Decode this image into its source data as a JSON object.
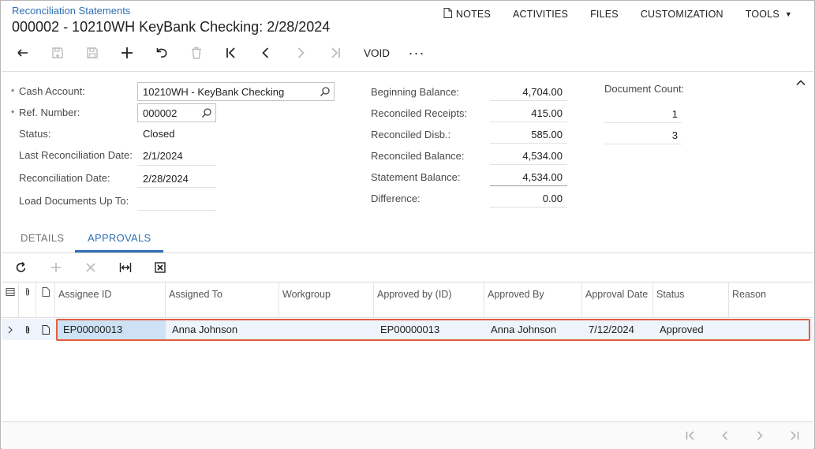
{
  "header": {
    "breadcrumb": "Reconciliation Statements",
    "title": "000002 - 10210WH KeyBank Checking: 2/28/2024",
    "links": {
      "notes": "NOTES",
      "activities": "ACTIVITIES",
      "files": "FILES",
      "customization": "CUSTOMIZATION",
      "tools": "TOOLS"
    }
  },
  "toolbar": {
    "void_label": "VOID",
    "more_label": "···",
    "icons": [
      "back-icon",
      "save-close-icon",
      "save-icon",
      "add-icon",
      "undo-icon",
      "delete-icon",
      "first-icon",
      "prev-icon",
      "next-icon",
      "last-icon"
    ]
  },
  "form": {
    "cash_account": {
      "label": "Cash Account:",
      "value": "10210WH - KeyBank Checking"
    },
    "ref_number": {
      "label": "Ref. Number:",
      "value": "000002"
    },
    "status": {
      "label": "Status:",
      "value": "Closed"
    },
    "last_reconciliation_date": {
      "label": "Last Reconciliation Date:",
      "value": "2/1/2024"
    },
    "reconciliation_date": {
      "label": "Reconciliation Date:",
      "value": "2/28/2024"
    },
    "load_documents_up_to": {
      "label": "Load Documents Up To:",
      "value": ""
    },
    "required_marker": "*"
  },
  "balances": {
    "beginning_balance": {
      "label": "Beginning Balance:",
      "value": "4,704.00"
    },
    "reconciled_receipts": {
      "label": "Reconciled Receipts:",
      "value": "415.00"
    },
    "reconciled_disb": {
      "label": "Reconciled Disb.:",
      "value": "585.00"
    },
    "reconciled_balance": {
      "label": "Reconciled Balance:",
      "value": "4,534.00"
    },
    "statement_balance": {
      "label": "Statement Balance:",
      "value": "4,534.00"
    },
    "difference": {
      "label": "Difference:",
      "value": "0.00"
    }
  },
  "document_count": {
    "label": "Document Count:",
    "receipts": "1",
    "disbursements": "3"
  },
  "tabs": [
    {
      "label": "DETAILS",
      "active": false
    },
    {
      "label": "APPROVALS",
      "active": true
    }
  ],
  "grid": {
    "columns": [
      "Assignee ID",
      "Assigned To",
      "Workgroup",
      "Approved by (ID)",
      "Approved By",
      "Approval Date",
      "Status",
      "Reason"
    ],
    "rows": [
      {
        "assignee_id": "EP00000013",
        "assigned_to": "Anna Johnson",
        "workgroup": "",
        "approved_by_id": "EP00000013",
        "approved_by": "Anna Johnson",
        "approval_date": "7/12/2024",
        "status": "Approved",
        "reason": ""
      }
    ]
  },
  "colors": {
    "accent": "#2e6fb4",
    "selected_row": "#eef4fb",
    "highlight_outline": "#e35d3f"
  }
}
